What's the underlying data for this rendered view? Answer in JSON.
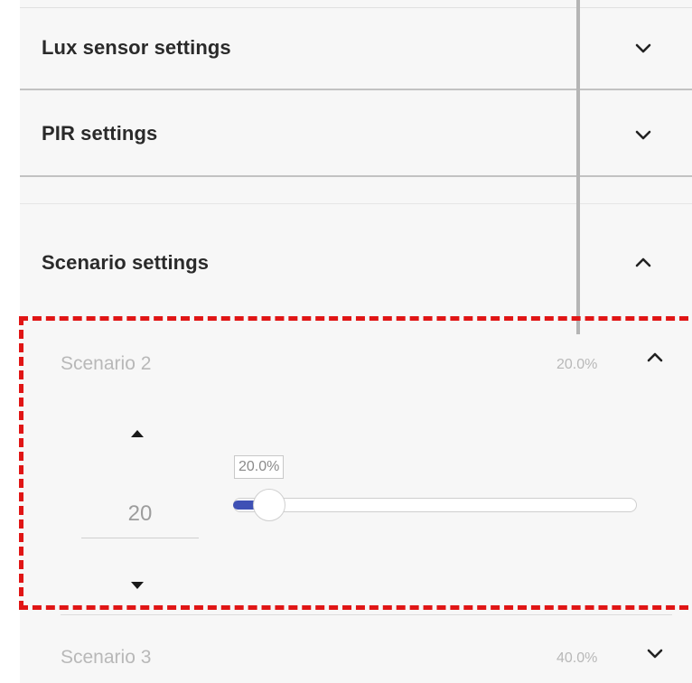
{
  "sections": {
    "lux": {
      "title": "Lux sensor settings",
      "chevron": "chevron-down-icon"
    },
    "pir": {
      "title": "PIR settings",
      "chevron": "chevron-down-icon"
    },
    "scenario": {
      "title": "Scenario settings",
      "chevron": "chevron-up-icon"
    }
  },
  "scenarios": [
    {
      "label": "Scenario 2",
      "value_text": "20.0%",
      "chevron": "chevron-up-icon",
      "expanded": true,
      "stepper": {
        "value": "20",
        "up_icon": "triangle-up-icon",
        "down_icon": "triangle-down-icon"
      },
      "slider": {
        "percent": 20.0,
        "tooltip": "20.0%",
        "min": 0,
        "max": 100
      }
    },
    {
      "label": "Scenario 3",
      "value_text": "40.0%",
      "chevron": "chevron-down-icon",
      "expanded": false
    }
  ],
  "colors": {
    "slider_fill": "#3f51b5",
    "highlight": "#e01515",
    "panel_bg": "#f7f7f7"
  }
}
